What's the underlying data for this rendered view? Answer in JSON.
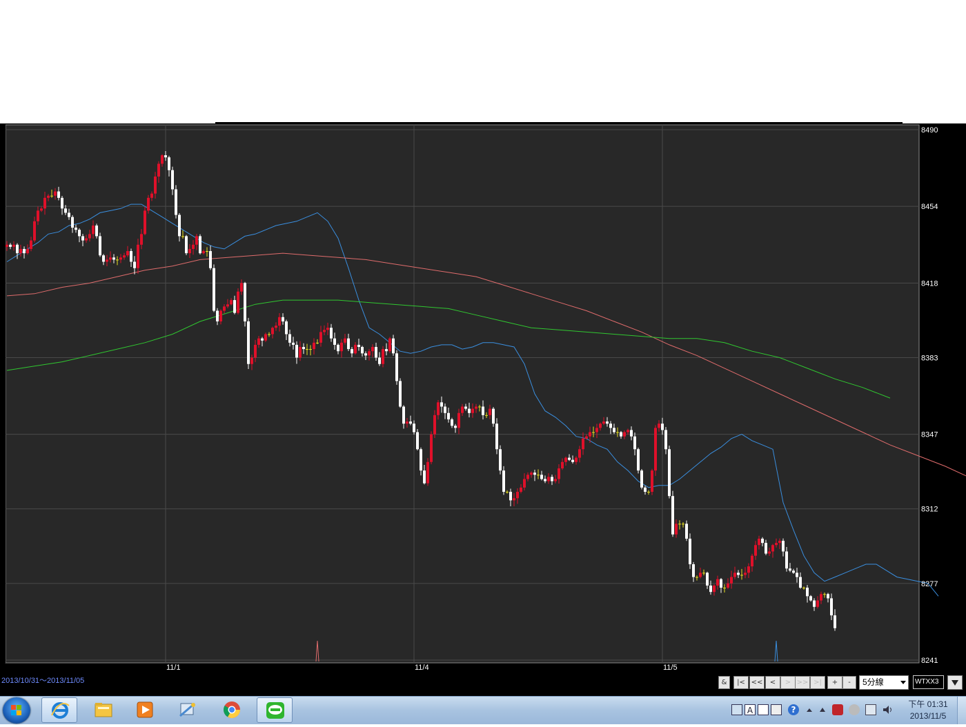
{
  "window": {
    "date_range": "2013/10/31～2013/11/05"
  },
  "toolbar": {
    "buttons": [
      "&",
      "|<",
      "<<",
      "<",
      ">",
      ">>",
      ">|",
      "+",
      "-"
    ],
    "period_value": "5分線",
    "symbol": "WTXX3"
  },
  "taskbar": {
    "items": [
      {
        "name": "internet-explorer-icon",
        "color": "#1e7fd6"
      },
      {
        "name": "folder-icon",
        "color": "#f4c542"
      },
      {
        "name": "media-player-icon",
        "color": "#f08020"
      },
      {
        "name": "network-tool-icon",
        "color": "#4a8ad0"
      },
      {
        "name": "chrome-icon",
        "color": "#dd4b39"
      },
      {
        "name": "line-app-icon",
        "color": "#2fb52f"
      }
    ],
    "tray": [
      "keyboard-icon",
      "A",
      "language-bar-icon",
      "input-options-icon",
      "?",
      "show-hidden-icons",
      "antivirus-icon",
      "usb-icon",
      "network-icon",
      "volume-icon"
    ],
    "clock_time": "下午 01:31",
    "clock_date": "2013/11/5"
  },
  "chart_data": {
    "type": "candlestick",
    "title": "",
    "x_labels": [
      {
        "label": "11/1",
        "index": 46
      },
      {
        "label": "11/4",
        "index": 118
      },
      {
        "label": "11/5",
        "index": 190
      }
    ],
    "y_ticks": [
      8490,
      8454,
      8418,
      8383,
      8347,
      8312,
      8277,
      8241
    ],
    "ylim": [
      8241,
      8490
    ],
    "grid": true,
    "colors": {
      "background": "#282828",
      "grid": "#4a4a4a",
      "up": "#e0102a",
      "down": "#ffffff",
      "doji": "#e8e020",
      "ma_short": "#3a8fe0",
      "ma_mid": "#e06c6c",
      "ma_long": "#30c830",
      "axis_text": "#ffffff"
    },
    "closes": [
      8436,
      8435,
      8436,
      8432,
      8434,
      8432,
      8434,
      8438,
      8447,
      8452,
      8453,
      8458,
      8459,
      8459,
      8461,
      8458,
      8453,
      8451,
      8449,
      8444,
      8443,
      8440,
      8438,
      8439,
      8441,
      8445,
      8440,
      8431,
      8428,
      8429,
      8430,
      8429,
      8429,
      8430,
      8431,
      8433,
      8428,
      8425,
      8436,
      8441,
      8452,
      8458,
      8460,
      8468,
      8474,
      8478,
      8477,
      8471,
      8462,
      8450,
      8440,
      8440,
      8432,
      8434,
      8436,
      8440,
      8432,
      8433,
      8433,
      8425,
      8405,
      8400,
      8405,
      8407,
      8408,
      8410,
      8404,
      8414,
      8418,
      8400,
      8380,
      8383,
      8389,
      8392,
      8391,
      8394,
      8394,
      8397,
      8398,
      8402,
      8400,
      8394,
      8390,
      8389,
      8383,
      8388,
      8387,
      8387,
      8387,
      8390,
      8390,
      8395,
      8396,
      8397,
      8392,
      8389,
      8386,
      8390,
      8392,
      8387,
      8385,
      8389,
      8388,
      8385,
      8384,
      8386,
      8388,
      8383,
      8380,
      8387,
      8386,
      8392,
      8385,
      8372,
      8360,
      8352,
      8353,
      8352,
      8348,
      8340,
      8330,
      8324,
      8334,
      8347,
      8356,
      8362,
      8360,
      8357,
      8354,
      8351,
      8350,
      8357,
      8360,
      8359,
      8357,
      8359,
      8360,
      8360,
      8356,
      8356,
      8359,
      8352,
      8340,
      8330,
      8320,
      8320,
      8316,
      8317,
      8320,
      8322,
      8326,
      8328,
      8329,
      8328,
      8328,
      8326,
      8325,
      8327,
      8325,
      8326,
      8331,
      8334,
      8336,
      8335,
      8334,
      8336,
      8340,
      8345,
      8346,
      8348,
      8348,
      8350,
      8352,
      8353,
      8352,
      8350,
      8348,
      8348,
      8346,
      8348,
      8349,
      8346,
      8340,
      8330,
      8322,
      8320,
      8320,
      8330,
      8350,
      8352,
      8349,
      8340,
      8318,
      8300,
      8305,
      8305,
      8305,
      8298,
      8286,
      8280,
      8280,
      8282,
      8282,
      8276,
      8273,
      8276,
      8279,
      8275,
      8275,
      8277,
      8280,
      8282,
      8281,
      8281,
      8282,
      8285,
      8290,
      8295,
      8298,
      8296,
      8291,
      8292,
      8295,
      8296,
      8297,
      8292,
      8284,
      8283,
      8282,
      8280,
      8275,
      8275,
      8271,
      8269,
      8266,
      8269,
      8272,
      8272,
      8270,
      8262,
      8256
    ],
    "series": [
      {
        "name": "",
        "start": 0,
        "values": [
          8428,
          8431,
          8434,
          8437,
          8441,
          8442,
          8445,
          8446,
          8448,
          8451,
          8452,
          8453,
          8455,
          8455,
          8452,
          8449,
          8446,
          8443,
          8440,
          8437,
          8435,
          8434,
          8437,
          8440,
          8441,
          8443,
          8445,
          8446,
          8447,
          8449,
          8451,
          8447,
          8439,
          8425,
          8410,
          8397,
          8394,
          8390,
          8386,
          8385,
          8386,
          8388,
          8389,
          8389,
          8387,
          8388,
          8390,
          8390,
          8389,
          8388,
          8380,
          8366,
          8358,
          8355,
          8351,
          8346,
          8345,
          8342,
          8340,
          8334,
          8330,
          8325,
          8322,
          8323,
          8323,
          8326,
          8330,
          8334,
          8338,
          8341,
          8345,
          8347,
          8344,
          8342,
          8340,
          8315,
          8302,
          8290,
          8282,
          8278,
          8280,
          8282,
          8284,
          8286,
          8286,
          8283,
          8280,
          8279,
          8278,
          8277,
          8271
        ]
      },
      {
        "name": "",
        "start": 0,
        "values": [
          8412,
          8413,
          8416,
          8418,
          8421,
          8424,
          8426,
          8429,
          8430,
          8431,
          8432,
          8431,
          8430,
          8429,
          8427,
          8425,
          8423,
          8421,
          8417,
          8413,
          8409,
          8405,
          8400,
          8395,
          8389,
          8384,
          8378,
          8372,
          8366,
          8360,
          8354,
          8348,
          8342,
          8337,
          8332,
          8326,
          8320
        ]
      },
      {
        "name": "",
        "start": 0,
        "values": [
          8377,
          8379,
          8381,
          8384,
          8387,
          8390,
          8394,
          8400,
          8404,
          8408,
          8410,
          8410,
          8410,
          8409,
          8408,
          8407,
          8406,
          8403,
          8400,
          8397,
          8396,
          8395,
          8394,
          8393,
          8392,
          8392,
          8390,
          8386,
          8383,
          8378,
          8373,
          8369,
          8364
        ]
      }
    ],
    "ma_stride": 3,
    "volume_spikes": [
      {
        "index": 90,
        "color": "#e06c6c"
      },
      {
        "index": 223,
        "color": "#3a8fe0"
      }
    ]
  }
}
